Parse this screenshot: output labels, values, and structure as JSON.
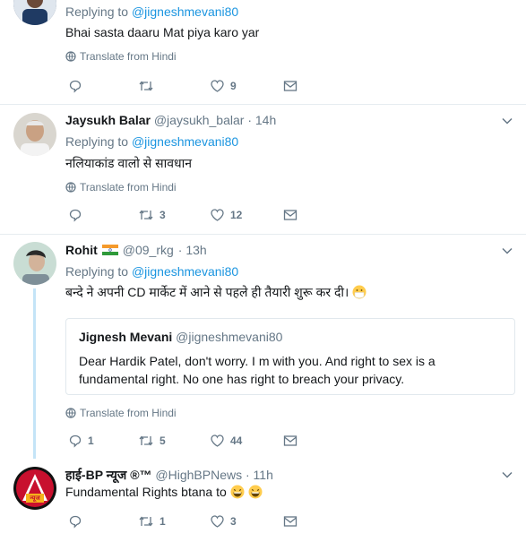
{
  "tweets": [
    {
      "reply_prefix": "Replying to",
      "reply_mention": "@jigneshmevani80",
      "text": "Bhai sasta daaru Mat piya karo yar",
      "translate": "Translate from Hindi",
      "likes": "9"
    },
    {
      "name": "Jaysukh Balar",
      "handle": "@jaysukh_balar",
      "time": "· 14h",
      "reply_prefix": "Replying to",
      "reply_mention": "@jigneshmevani80",
      "text": "नलियाकांड वालो से सावधान",
      "translate": "Translate from Hindi",
      "retweets": "3",
      "likes": "12"
    },
    {
      "name": "Rohit",
      "handle": "@09_rkg",
      "time": "· 13h",
      "reply_prefix": "Replying to",
      "reply_mention": "@jigneshmevani80",
      "text": "बन्दे ने अपनी CD मार्केट में आने से पहले ही तैयारी शुरू कर दी।",
      "quote_name": "Jignesh Mevani",
      "quote_handle": "@jigneshmevani80",
      "quote_text": "Dear Hardik Patel, don't worry. I m with you. And right to sex is a fundamental right. No one has right to breach your privacy.",
      "translate": "Translate from Hindi",
      "replies": "1",
      "retweets": "5",
      "likes": "44"
    },
    {
      "name": "हाई-BP न्यूज ®™",
      "handle": "@HighBPNews",
      "time": "· 11h",
      "text": "Fundamental Rights btana to",
      "retweets": "1",
      "likes": "3",
      "avatar_caption": "न्यूज"
    }
  ],
  "colors": {
    "link": "#1b95e0",
    "muted": "#657786",
    "thread_line": "#c4e4f7"
  }
}
